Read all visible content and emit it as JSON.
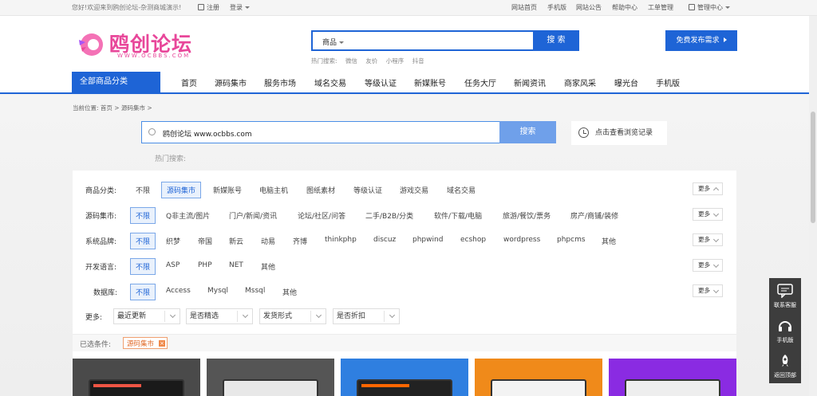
{
  "topbar": {
    "welcome": "您好!欢迎来到鸥创论坛-杂测商城演示!",
    "register": "注册",
    "login": "登录",
    "links": [
      "网站首页",
      "手机版",
      "网站公告",
      "帮助中心",
      "工单管理"
    ],
    "manage": "管理中心"
  },
  "logo": {
    "name": "鸥创论坛",
    "sub": "WWW.OCBBS.COM"
  },
  "search_top": {
    "category": "商品",
    "button": "搜 索"
  },
  "hot_top": {
    "label": "热门搜索:",
    "items": [
      "微信",
      "友价",
      "小程序",
      "抖音"
    ]
  },
  "publish": {
    "label": "免费发布需求"
  },
  "nav": {
    "all": "全部商品分类",
    "items": [
      "首页",
      "源码集市",
      "服务市场",
      "域名交易",
      "等级认证",
      "新媒账号",
      "任务大厅",
      "新闻资讯",
      "商家风采",
      "曝光台",
      "手机版"
    ]
  },
  "breadcrumb": {
    "label": "当前位置:",
    "home": "首页",
    "current": "源码集市"
  },
  "search_mid": {
    "value": "鸥创论坛 www.ocbbs.com",
    "button": "搜索",
    "history": "点击查看浏览记录",
    "hot_label": "热门搜索:"
  },
  "filters": [
    {
      "label": "商品分类:",
      "options": [
        "不限",
        "源码集市",
        "新媒账号",
        "电脑主机",
        "图纸素材",
        "等级认证",
        "游戏交易",
        "域名交易"
      ],
      "active": 1,
      "more": "更多",
      "expanded": true
    },
    {
      "label": "源码集市:",
      "options": [
        "不限",
        "Q非主流/图片",
        "门户/新闻/资讯",
        "论坛/社区/问答",
        "二手/B2B/分类",
        "软件/下载/电脑",
        "旅游/餐饮/票务",
        "房产/商铺/装修"
      ],
      "active": 0,
      "more": "更多",
      "expanded": false
    },
    {
      "label": "系统品牌:",
      "options": [
        "不限",
        "织梦",
        "帝国",
        "新云",
        "动易",
        "齐博",
        "thinkphp",
        "discuz",
        "phpwind",
        "ecshop",
        "wordpress",
        "phpcms",
        "其他"
      ],
      "active": 0,
      "more": "更多",
      "expanded": false
    },
    {
      "label": "开发语言:",
      "options": [
        "不限",
        "ASP",
        "PHP",
        "NET",
        "其他"
      ],
      "active": 0,
      "more": "更多",
      "expanded": false
    },
    {
      "label": "数据库:",
      "options": [
        "不限",
        "Access",
        "Mysql",
        "Mssql",
        "其他"
      ],
      "active": 0,
      "more": "更多",
      "expanded": false
    }
  ],
  "more_row": {
    "label": "更多:",
    "selects": [
      "最近更新",
      "是否精选",
      "发货形式",
      "是否折扣"
    ]
  },
  "chosen": {
    "label": "已选条件:",
    "tag": "源码集市",
    "remove": "×"
  },
  "float": {
    "items": [
      "联系客服",
      "手机版",
      "返回顶部"
    ]
  },
  "colors": {
    "primary": "#1e64d6",
    "logo": "#e8479a",
    "tag": "#e06b2a"
  }
}
